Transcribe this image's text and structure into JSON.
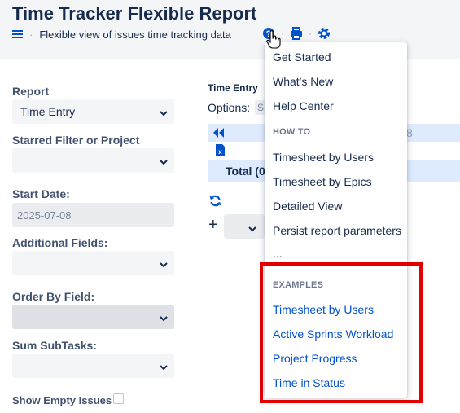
{
  "header": {
    "title": "Time Tracker Flexible Report",
    "subtitle": "Flexible view of issues time tracking data",
    "icons": [
      "menu-icon",
      "help-icon",
      "print-icon",
      "settings-icon"
    ]
  },
  "sidebar": {
    "report_label": "Report",
    "report_value": "Time Entry",
    "filter_label": "Starred Filter or Project",
    "filter_value": "",
    "start_date_label": "Start Date:",
    "start_date_value": "2025-07-08",
    "additional_fields_label": "Additional Fields:",
    "order_by_label": "Order By Field:",
    "sum_subtasks_label": "Sum SubTasks:",
    "show_empty_label": "Show Empty Issues"
  },
  "main": {
    "section_title": "Time Entry",
    "options_label": "Options:",
    "options_value": "S",
    "period_number": "8",
    "total_label": "Total (0"
  },
  "help_menu": {
    "items": [
      "Get Started",
      "What's New",
      "Help Center"
    ],
    "howto_heading": "HOW TO",
    "howto_items": [
      "Timesheet by Users",
      "Timesheet by Epics",
      "Detailed View",
      "Persist report parameters",
      "..."
    ],
    "examples_heading": "EXAMPLES",
    "example_items": [
      "Timesheet by Users",
      "Active Sprints Workload",
      "Project Progress",
      "Time in Status"
    ]
  },
  "colors": {
    "accent": "#0052cc",
    "highlight_box": "#e00000",
    "header_bg": "#f4f5f7",
    "row_bg": "#deebff"
  }
}
